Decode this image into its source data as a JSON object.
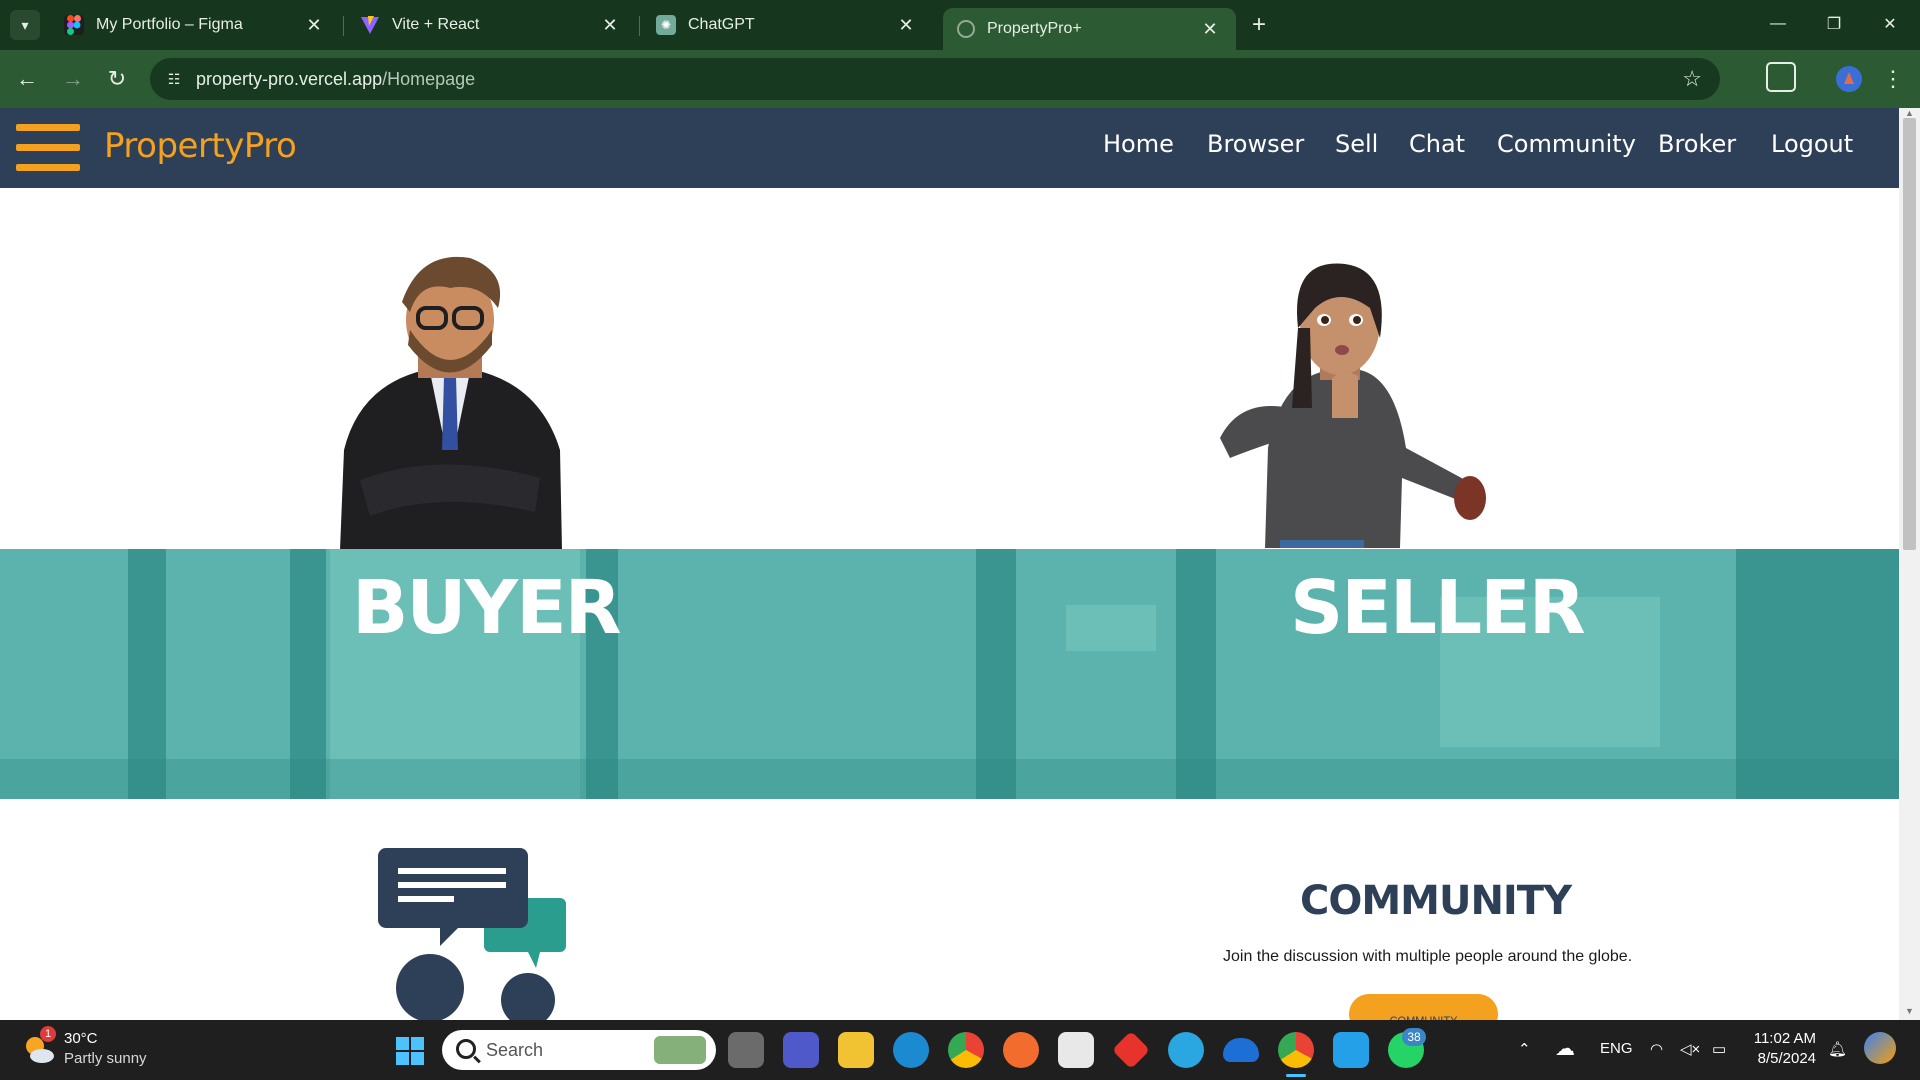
{
  "browser": {
    "tabs": [
      {
        "title": "My Portfolio – Figma",
        "icon": "figma-icon"
      },
      {
        "title": "Vite + React",
        "icon": "vite-icon"
      },
      {
        "title": "ChatGPT",
        "icon": "chatgpt-icon"
      },
      {
        "title": "PropertyPro+",
        "icon": "globe-icon",
        "active": true
      }
    ],
    "url_host": "property-pro.vercel.app",
    "url_path": "/Homepage"
  },
  "site": {
    "logo": "PropertyPro",
    "nav": [
      "Home",
      "Browser",
      "Sell",
      "Chat",
      "Community",
      "Broker",
      "Logout"
    ],
    "hero": {
      "buyer": "BUYER",
      "seller": "SELLER"
    },
    "community": {
      "title": "COMMUNITY",
      "description": "Join the discussion with multiple people around the globe.",
      "button": "COMMUNITY"
    },
    "colors": {
      "header": "#2e4057",
      "accent": "#f4a11f",
      "band": "#5cb3ad",
      "chat_green": "#2a9d8f"
    }
  },
  "taskbar": {
    "weather_temp": "30°C",
    "weather_desc": "Partly sunny",
    "weather_badge": "1",
    "search_placeholder": "Search",
    "whatsapp_badge": "38",
    "language": "ENG",
    "time": "11:02 AM",
    "date": "8/5/2024"
  }
}
